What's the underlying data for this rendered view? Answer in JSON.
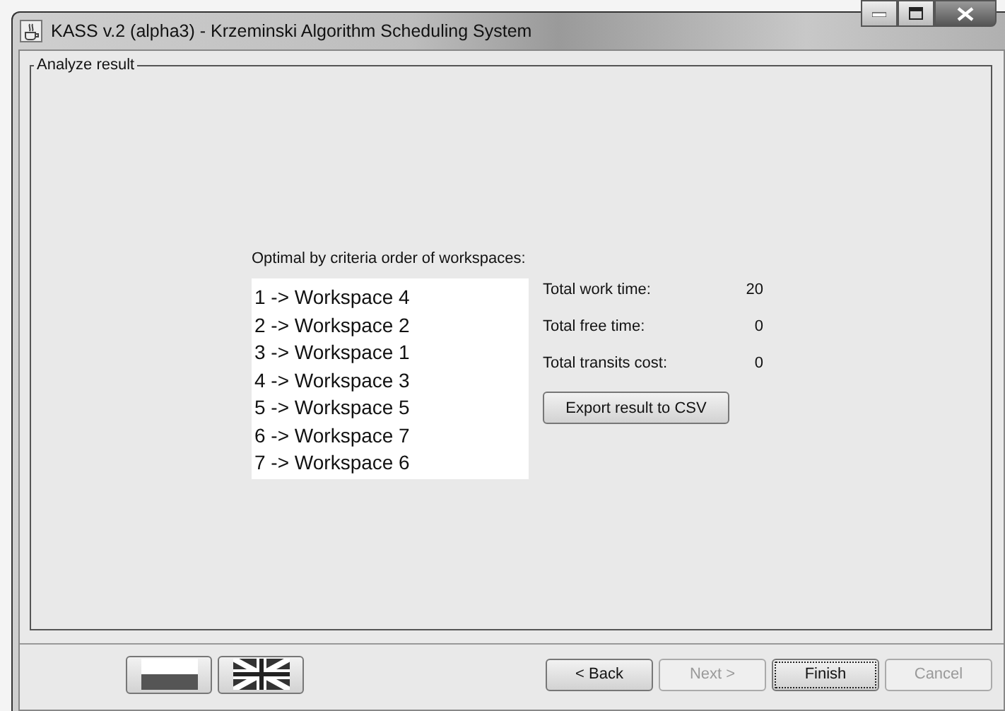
{
  "window": {
    "title": "KASS v.2 (alpha3) - Krzeminski Algorithm Scheduling System"
  },
  "group": {
    "title": "Analyze result",
    "list_label": "Optimal by criteria order of workspaces:",
    "order": [
      "1 -> Workspace 4",
      "2 -> Workspace 2",
      "3 -> Workspace 1",
      "4 -> Workspace 3",
      "5 -> Workspace 5",
      "6 -> Workspace 7",
      "7 -> Workspace 6"
    ],
    "stats": [
      {
        "label": "Total work time:",
        "value": "20"
      },
      {
        "label": "Total free time:",
        "value": "0"
      },
      {
        "label": "Total transits cost:",
        "value": "0"
      }
    ],
    "export_button": "Export result to CSV"
  },
  "languages": [
    {
      "kind": "polish"
    },
    {
      "kind": "british"
    }
  ],
  "buttons": [
    {
      "label": "< Back",
      "disabled": false,
      "focused": false
    },
    {
      "label": "Next >",
      "disabled": true,
      "focused": false
    },
    {
      "label": "Finish",
      "disabled": false,
      "focused": true
    },
    {
      "label": "Cancel",
      "disabled": true,
      "focused": false
    }
  ]
}
